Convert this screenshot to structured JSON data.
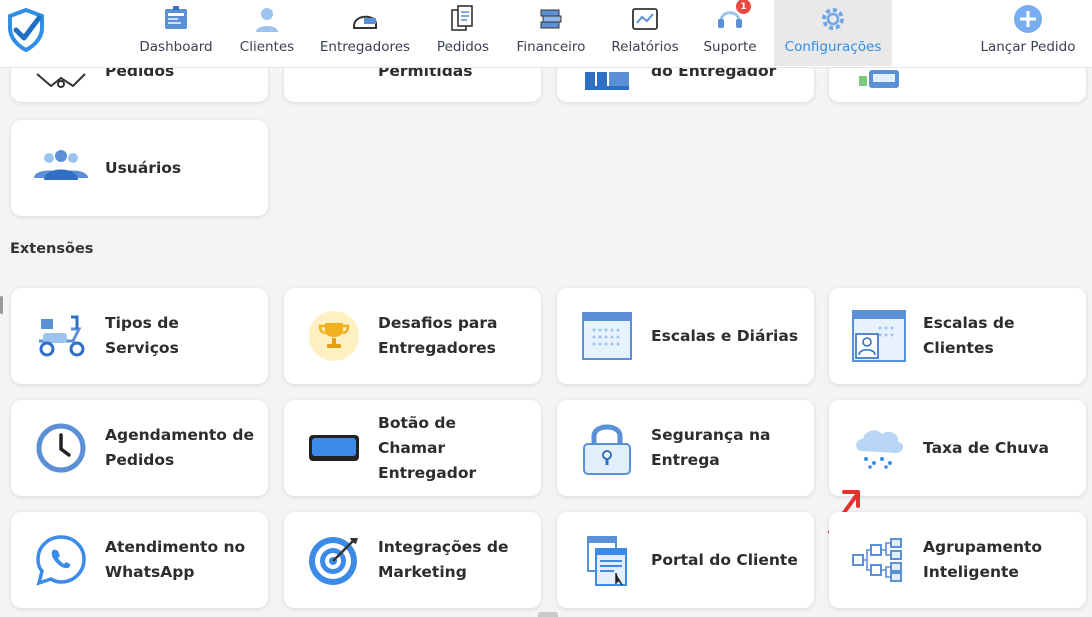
{
  "nav": {
    "items": [
      {
        "label": "Dashboard",
        "icon": "dashboard-icon"
      },
      {
        "label": "Clientes",
        "icon": "user-icon"
      },
      {
        "label": "Entregadores",
        "icon": "helmet-icon"
      },
      {
        "label": "Pedidos",
        "icon": "orders-icon"
      },
      {
        "label": "Financeiro",
        "icon": "money-icon"
      },
      {
        "label": "Relatórios",
        "icon": "report-icon"
      },
      {
        "label": "Suporte",
        "icon": "headset-icon",
        "badge": "1"
      },
      {
        "label": "Configurações",
        "icon": "gear-icon",
        "active": true
      }
    ],
    "launch_label": "Lançar Pedido"
  },
  "top_partial_cards": [
    {
      "label": "Pedidos"
    },
    {
      "label": "Permitidas"
    },
    {
      "label": "do Entregador"
    },
    {
      "label": ""
    }
  ],
  "users_card": {
    "label": "Usuários"
  },
  "extensions": {
    "title": "Extensões",
    "cards": [
      {
        "label": "Tipos de Serviços",
        "icon": "scooter-icon"
      },
      {
        "label": "Desafios para Entregadores",
        "icon": "trophy-icon"
      },
      {
        "label": "Escalas e Diárias",
        "icon": "calendar-icon"
      },
      {
        "label": "Escalas de Clientes",
        "icon": "client-calendar-icon"
      },
      {
        "label": "Agendamento de Pedidos",
        "icon": "clock-icon"
      },
      {
        "label": "Botão de Chamar Entregador",
        "icon": "button-icon"
      },
      {
        "label": "Segurança na Entrega",
        "icon": "lock-icon"
      },
      {
        "label": "Taxa de Chuva",
        "icon": "rain-cloud-icon"
      },
      {
        "label": "Atendimento no WhatsApp",
        "icon": "whatsapp-icon"
      },
      {
        "label": "Integrações de Marketing",
        "icon": "target-icon"
      },
      {
        "label": "Portal do Cliente",
        "icon": "portal-icon"
      },
      {
        "label": "Agrupamento Inteligente",
        "icon": "hierarchy-icon"
      }
    ]
  },
  "colors": {
    "accent": "#2f8ee5",
    "annotation_arrow": "#e8312f",
    "badge": "#e84a3f"
  }
}
